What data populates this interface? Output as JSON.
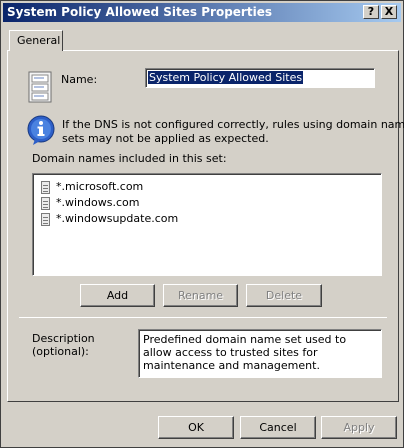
{
  "window": {
    "title": "System Policy Allowed Sites Properties",
    "help_label": "?",
    "close_label": "X"
  },
  "tabs": [
    {
      "label": "General",
      "selected": true
    }
  ],
  "name_field": {
    "label": "Name:",
    "value": "System Policy Allowed Sites"
  },
  "info": {
    "icon": "info-icon",
    "text_line1": "If the DNS is not configured correctly, rules using domain name",
    "text_line2": "sets may not be applied as expected."
  },
  "domains": {
    "label": "Domain names included in this set:",
    "items": [
      {
        "label": "*.microsoft.com"
      },
      {
        "label": "*.windows.com"
      },
      {
        "label": "*.windowsupdate.com"
      }
    ]
  },
  "list_buttons": {
    "add": "Add",
    "rename": "Rename",
    "delete": "Delete"
  },
  "description": {
    "label_line1": "Description",
    "label_line2": "(optional):",
    "value": "Predefined domain name set used to allow access to trusted sites for maintenance and management."
  },
  "footer_buttons": {
    "ok": "OK",
    "cancel": "Cancel",
    "apply": "Apply"
  }
}
